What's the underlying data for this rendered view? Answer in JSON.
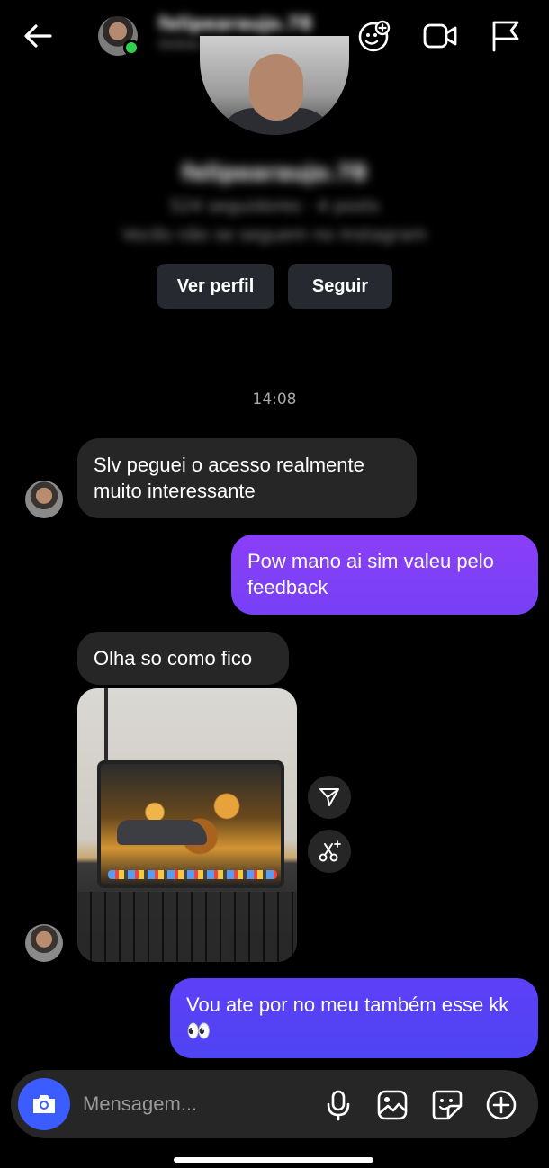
{
  "header": {
    "contact_name": "felipearaujo.78",
    "status": "Online agora",
    "icons": [
      "back-arrow-icon",
      "add-people-icon",
      "video-camera-icon",
      "flag-icon"
    ]
  },
  "profile": {
    "username": "felipearaujo.78",
    "stats": "524 seguidores · 4 posts",
    "relation": "Vocês não se seguem no Instagram",
    "view_profile_label": "Ver perfil",
    "follow_label": "Seguir"
  },
  "conversation": {
    "timestamp": "14:08",
    "messages": [
      {
        "direction": "in",
        "text": "Slv peguei o acesso realmente muito interessante"
      },
      {
        "direction": "out",
        "text": "Pow mano ai sim valeu pelo feedback"
      },
      {
        "direction": "in",
        "text": "Olha so como fico"
      },
      {
        "direction": "in",
        "type": "photo",
        "content": "laptop-photo"
      },
      {
        "direction": "out",
        "text": "Vou ate por no meu também esse kk👀"
      }
    ]
  },
  "colors": {
    "outgoing_top": "#8a3ff7",
    "outgoing_bottom": "#5a3ef5",
    "incoming": "#262626",
    "camera_button": "#3b5cff",
    "background": "#000000"
  },
  "composer": {
    "placeholder": "Mensagem...",
    "icons": [
      "camera-icon",
      "microphone-icon",
      "gallery-icon",
      "sticker-icon",
      "plus-icon"
    ]
  }
}
